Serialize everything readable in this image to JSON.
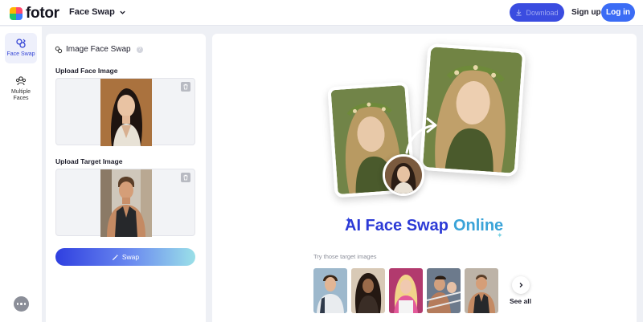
{
  "header": {
    "logo_text": "fotor",
    "product_menu_label": "Face Swap",
    "download_label": "Download",
    "signup_label": "Sign up",
    "login_label": "Log in"
  },
  "rail": {
    "items": [
      {
        "label": "Face Swap",
        "icon": "face-swap-icon",
        "active": true
      },
      {
        "label": "Multiple Faces",
        "icon": "multiple-faces-icon",
        "active": false
      }
    ],
    "more_icon": "more-icon"
  },
  "panel": {
    "title": "Image Face Swap",
    "help_glyph": "?",
    "upload_face_label": "Upload Face Image",
    "upload_target_label": "Upload Target Image",
    "swap_label": "Swap"
  },
  "stage": {
    "headline_a": "AI Face Swap",
    "headline_b": "Online",
    "try_label": "Try those target images",
    "see_all_label": "See all"
  },
  "colors": {
    "brand_blue": "#3b6cf5",
    "download_blue": "#3a4ce0",
    "headline_blue": "#2c3ad6",
    "headline_teal": "#3aa3d8"
  }
}
